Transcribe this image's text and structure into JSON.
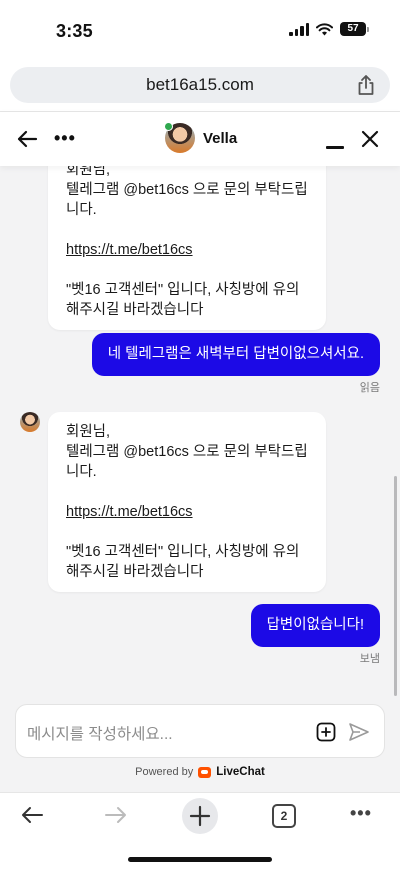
{
  "status_bar": {
    "time": "3:35",
    "battery": "57"
  },
  "browser": {
    "url": "bet16a15.com",
    "tabs_count": "2"
  },
  "chat_header": {
    "agent_name": "Vella",
    "more_label": "•••"
  },
  "messages": {
    "first": {
      "partial_top": "회원님,",
      "line1": "텔레그램 @bet16cs 으로 문의 부탁드립니다.",
      "link": "https://t.me/bet16cs",
      "line2": "\"벳16 고객센터\" 입니다, 사칭방에 유의해주시길 바라겠습니다"
    },
    "reply1": {
      "text": "네 텔레그램은 새벽부터 답변이없으셔서요.",
      "status": "읽음"
    },
    "second": {
      "greeting": "회원님,",
      "line1": "텔레그램 @bet16cs 으로 문의 부탁드립니다.",
      "link": "https://t.me/bet16cs",
      "line2": "\"벳16 고객센터\" 입니다, 사칭방에 유의해주시길 바라겠습니다"
    },
    "reply2": {
      "text": "답변이없습니다!",
      "status": "보냄"
    }
  },
  "composer": {
    "placeholder": "메시지를 작성하세요...",
    "powered_by": "Powered by",
    "brand": "LiveChat"
  },
  "bottom_bar": {
    "more_label": "•••"
  },
  "colors": {
    "outgoing_bubble": "#1c0ae6",
    "online": "#2fa84f",
    "livechat_brand": "#ff5100"
  }
}
